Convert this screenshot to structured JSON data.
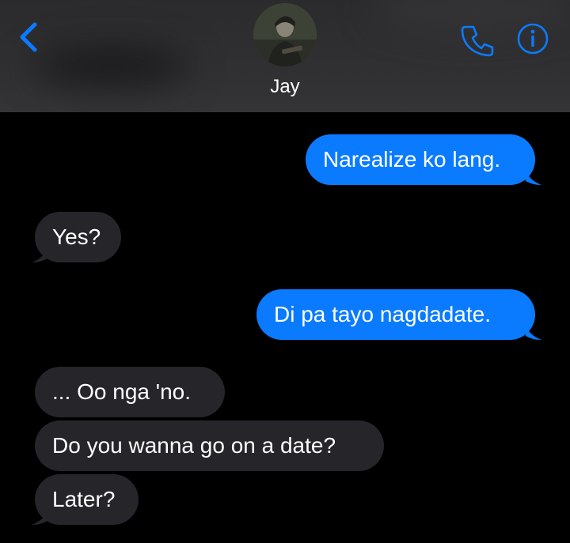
{
  "header": {
    "contact_name": "Jay",
    "back_icon": "chevron-left-icon",
    "call_icon": "phone-icon",
    "info_icon": "info-icon",
    "accent_color": "#0a7bff"
  },
  "messages": [
    {
      "direction": "sent",
      "text": "Narealize ko lang."
    },
    {
      "direction": "received",
      "text": "Yes?"
    },
    {
      "direction": "sent",
      "text": "Di pa tayo nagdadate."
    },
    {
      "direction": "received",
      "text": "... Oo nga 'no."
    },
    {
      "direction": "received",
      "text": "Do you wanna go on a date?"
    },
    {
      "direction": "received",
      "text": "Later?"
    }
  ],
  "colors": {
    "sent_bubble": "#0a7bff",
    "received_bubble": "#26252a",
    "background": "#000000"
  }
}
